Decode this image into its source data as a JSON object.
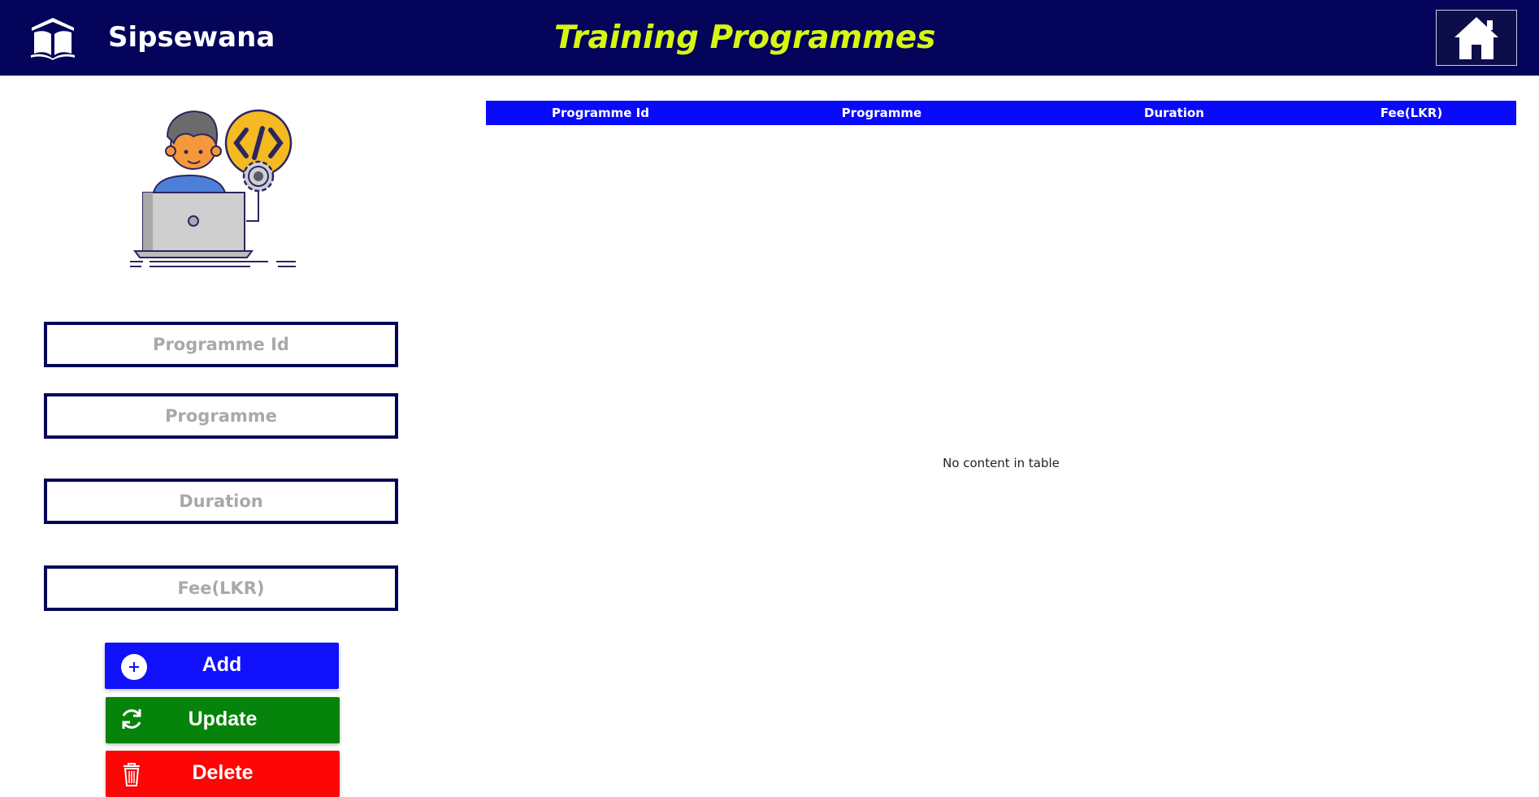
{
  "header": {
    "brand": "Sipsewana",
    "title": "Training Programmes",
    "brand_icon": "open-book-icon",
    "home_icon": "home-icon"
  },
  "form": {
    "programme_id": {
      "placeholder": "Programme Id",
      "value": ""
    },
    "programme": {
      "placeholder": "Programme",
      "value": ""
    },
    "duration": {
      "placeholder": "Duration",
      "value": ""
    },
    "fee": {
      "placeholder": "Fee(LKR)",
      "value": ""
    }
  },
  "buttons": {
    "add": "Add",
    "update": "Update",
    "delete": "Delete"
  },
  "table": {
    "columns": [
      "Programme Id",
      "Programme",
      "Duration",
      "Fee(LKR)"
    ],
    "rows": [],
    "empty_message": "No content in table"
  },
  "colors": {
    "header_bg": "#04045a",
    "title_color": "#d6f70f",
    "add": "#1010fb",
    "update": "#06830a",
    "delete": "#fc0606",
    "table_header": "#0a0afa"
  }
}
